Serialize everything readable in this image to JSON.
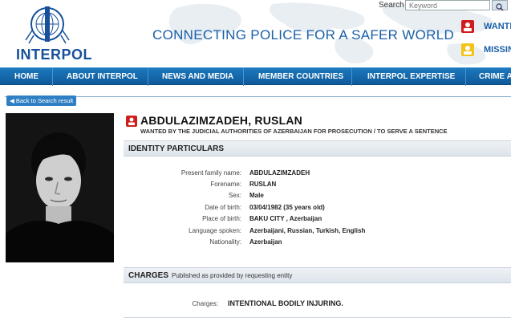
{
  "header": {
    "logo_text": "INTERPOL",
    "slogan": "CONNECTING POLICE FOR A SAFER WORLD",
    "search_label": "Search :",
    "search_placeholder": "Keyword",
    "side_links": [
      {
        "label": "WANTED",
        "icon": "wanted-icon"
      },
      {
        "label": "MISSING",
        "icon": "missing-icon"
      }
    ]
  },
  "nav": {
    "items": [
      "HOME",
      "ABOUT INTERPOL",
      "NEWS AND MEDIA",
      "MEMBER COUNTRIES",
      "INTERPOL EXPERTISE",
      "CRIME AREAS"
    ]
  },
  "notice": {
    "back_label": "Back to Search result",
    "name": "ABDULAZIMZADEH, RUSLAN",
    "wanted_by": "WANTED BY THE JUDICIAL AUTHORITIES OF AZERBAIJAN FOR PROSECUTION / TO SERVE A SENTENCE",
    "identity_title": "IDENTITY PARTICULARS",
    "particulars": [
      {
        "label": "Present family name:",
        "value": "ABDULAZIMZADEH"
      },
      {
        "label": "Forename:",
        "value": "RUSLAN"
      },
      {
        "label": "Sex:",
        "value": "Male"
      },
      {
        "label": "Date of birth:",
        "value": "03/04/1982 (35 years old)"
      },
      {
        "label": "Place of birth:",
        "value": "BAKU CITY , Azerbaijan"
      },
      {
        "label": "Language spoken:",
        "value": "Azerbaijani, Russian, Turkish, English"
      },
      {
        "label": "Nationality:",
        "value": "Azerbaijan"
      }
    ],
    "charges_title": "CHARGES",
    "charges_subtitle": "Published as provided by requesting entity",
    "charges_label": "Charges:",
    "charges_value": "INTENTIONAL BODILY INJURING."
  },
  "colors": {
    "brand_blue": "#17509b",
    "nav_blue": "#1c78bd",
    "notice_red": "#d01c1c"
  }
}
